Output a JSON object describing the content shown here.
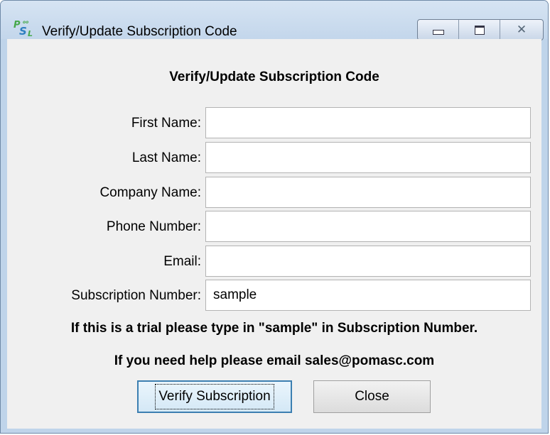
{
  "window": {
    "title": "Verify/Update Subscription Code",
    "icon_name": "pomasc-psl-logo-icon",
    "icon_letters": {
      "p": "P",
      "s": "S",
      "l": "L",
      "tiny": "oo"
    },
    "caption_buttons": {
      "minimize_icon": "minimize-icon",
      "maximize_icon": "maximize-icon",
      "close_icon": "close-icon",
      "close_glyph": "✕"
    }
  },
  "dialog": {
    "heading": "Verify/Update Subscription Code",
    "fields": [
      {
        "label": "First Name:",
        "value": ""
      },
      {
        "label": "Last Name:",
        "value": ""
      },
      {
        "label": "Company Name:",
        "value": ""
      },
      {
        "label": "Phone Number:",
        "value": ""
      },
      {
        "label": "Email:",
        "value": ""
      },
      {
        "label": "Subscription Number:",
        "value": "sample"
      }
    ],
    "trial_note": "If this is a trial please type in \"sample\" in Subscription Number.",
    "help_note": "If you need help please email sales@pomasc.com",
    "buttons": {
      "verify": "Verify Subscription",
      "close": "Close"
    }
  },
  "colors": {
    "frame": "#bfd4ea",
    "client_background": "#f0f0f0",
    "default_button_border": "#3c7fb1"
  }
}
